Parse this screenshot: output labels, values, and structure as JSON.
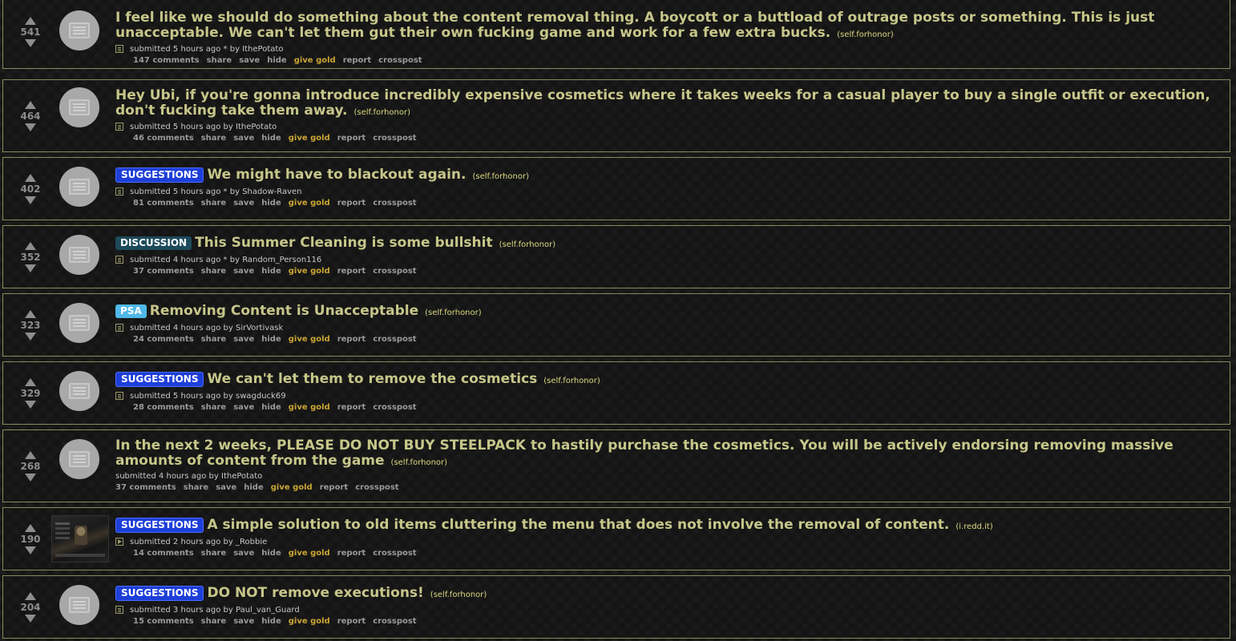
{
  "posts": [
    {
      "score": "541",
      "title": "I feel like we should do something about the content removal thing. A boycott or a buttload of outrage posts or something. This is just unacceptable. We can't let them gut their own fucking game and work for a few extra bucks.",
      "domain": "(self.forhonor)",
      "flair": "",
      "submitted": "submitted 5 hours ago * by",
      "author": "IthePotato",
      "comments": "147 comments"
    },
    {
      "score": "464",
      "title": "Hey Ubi, if you're gonna introduce incredibly expensive cosmetics where it takes weeks for a casual player to buy a single outfit or execution, don't fucking take them away.",
      "domain": "(self.forhonor)",
      "flair": "",
      "submitted": "submitted 5 hours ago by",
      "author": "IthePotato",
      "comments": "46 comments"
    },
    {
      "score": "402",
      "title": "We might have to blackout again.",
      "domain": "(self.forhonor)",
      "flair": "SUGGESTIONS",
      "submitted": "submitted 5 hours ago * by",
      "author": "Shadow-Raven",
      "comments": "81 comments"
    },
    {
      "score": "352",
      "title": "This Summer Cleaning is some bullshit",
      "domain": "(self.forhonor)",
      "flair": "DISCUSSION",
      "submitted": "submitted 4 hours ago * by",
      "author": "Random_Person116",
      "comments": "37 comments"
    },
    {
      "score": "323",
      "title": "Removing Content is Unacceptable",
      "domain": "(self.forhonor)",
      "flair": "PSA",
      "submitted": "submitted 4 hours ago by",
      "author": "SirVortivask",
      "comments": "24 comments"
    },
    {
      "score": "329",
      "title": "We can't let them to remove the cosmetics",
      "domain": "(self.forhonor)",
      "flair": "SUGGESTIONS",
      "submitted": "submitted 5 hours ago by",
      "author": "swagduck69",
      "comments": "28 comments"
    },
    {
      "score": "268",
      "title": "In the next 2 weeks, PLEASE DO NOT BUY STEELPACK to hastily purchase the cosmetics. You will be actively endorsing removing massive amounts of content from the game",
      "domain": "(self.forhonor)",
      "flair": "",
      "submitted": "submitted 4 hours ago by",
      "author": "IthePotato",
      "comments": "37 comments"
    },
    {
      "score": "190",
      "title": "A simple solution to old items cluttering the menu that does not involve the removal of content.",
      "domain": "(i.redd.it)",
      "flair": "SUGGESTIONS",
      "submitted": "submitted 2 hours ago by",
      "author": "_Robbie",
      "comments": "14 comments"
    },
    {
      "score": "204",
      "title": "DO NOT remove executions!",
      "domain": "(self.forhonor)",
      "flair": "SUGGESTIONS",
      "submitted": "submitted 3 hours ago by",
      "author": "Paul_van_Guard",
      "comments": "15 comments"
    }
  ],
  "actions": {
    "share": "share",
    "save": "save",
    "hide": "hide",
    "give_gold": "give gold",
    "report": "report",
    "crosspost": "crosspost"
  },
  "colors": {
    "title": "#c6c68a",
    "border": "#8a8a5c",
    "gold": "#c9a534",
    "suggestions_flair": "#1e3fd8",
    "discussion_flair": "#1d4a5a",
    "psa_flair": "#4fb8e8"
  }
}
